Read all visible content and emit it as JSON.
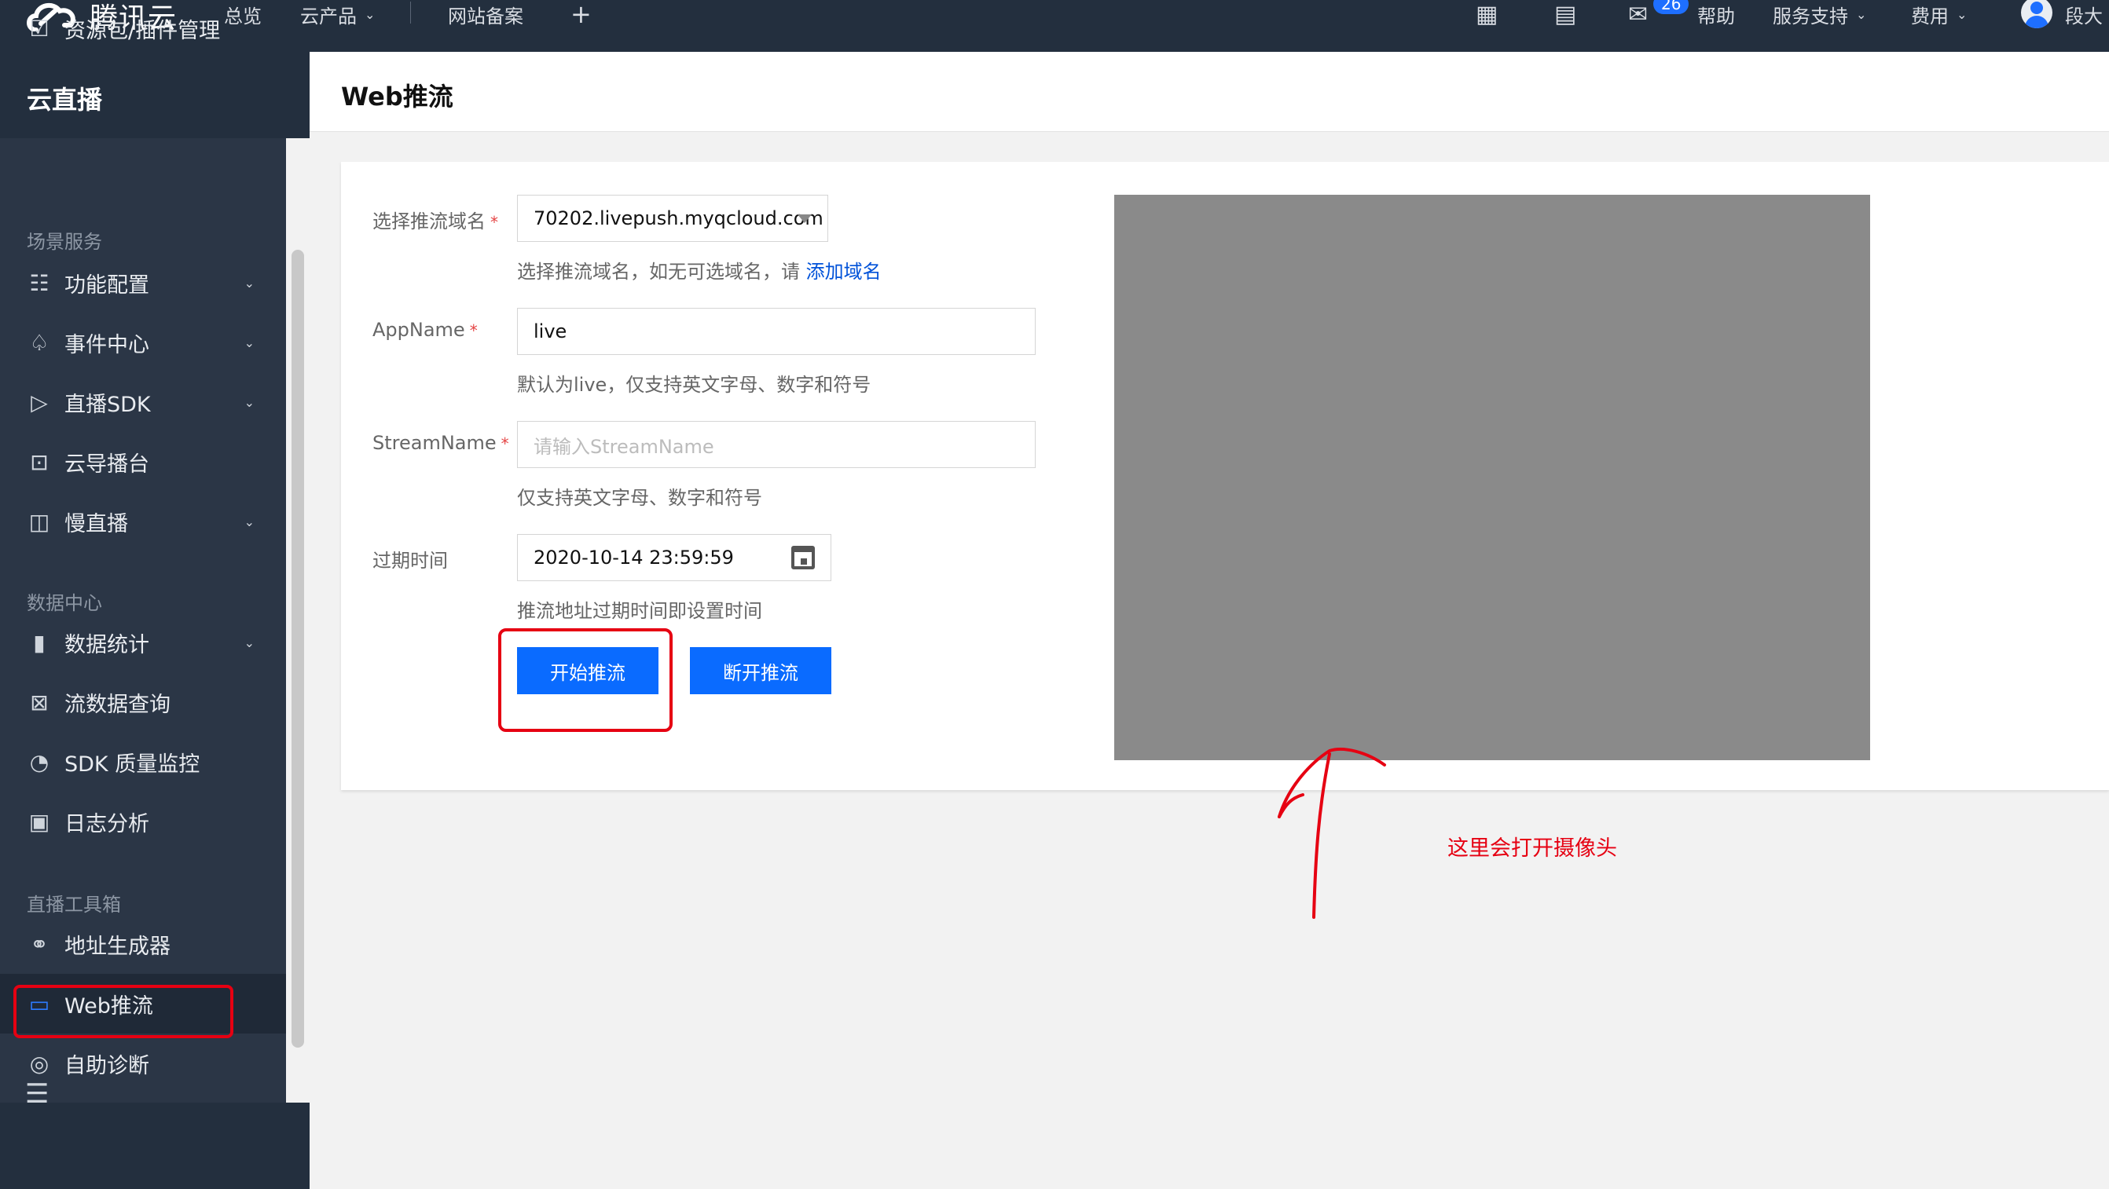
{
  "brand": {
    "name": "腾讯云"
  },
  "topnav": {
    "items": [
      "总览",
      "云产品",
      "网站备案"
    ],
    "plus": "+",
    "mail_badge": "26",
    "help": "帮助",
    "support": "服务支持",
    "billing": "费用",
    "user": "段大"
  },
  "sidebar": {
    "title": "云直播",
    "items": [
      {
        "label": "资源包/插件管理",
        "icon": "package-icon"
      },
      {
        "label": "功能配置",
        "icon": "sliders-icon"
      },
      {
        "label": "事件中心",
        "icon": "bell-icon"
      },
      {
        "label": "直播SDK",
        "icon": "play-icon"
      },
      {
        "label": "云导播台",
        "icon": "monitor-icon"
      },
      {
        "label": "慢直播",
        "icon": "camera-icon"
      },
      {
        "label": "数据统计",
        "icon": "bar-chart-icon"
      },
      {
        "label": "流数据查询",
        "icon": "line-chart-icon"
      },
      {
        "label": "SDK 质量监控",
        "icon": "gauge-icon"
      },
      {
        "label": "日志分析",
        "icon": "calendar-icon"
      },
      {
        "label": "地址生成器",
        "icon": "link-icon"
      },
      {
        "label": "Web推流",
        "icon": "window-icon"
      },
      {
        "label": "自助诊断",
        "icon": "diagnose-icon"
      }
    ],
    "groups": [
      "场景服务",
      "数据中心",
      "直播工具箱"
    ],
    "active_color": "#2d7bff"
  },
  "page": {
    "title": "Web推流"
  },
  "form": {
    "domain": {
      "label": "选择推流域名",
      "value": "70202.livepush.myqcloud.com",
      "hint": "选择推流域名，如无可选域名，请 ",
      "hint_link": "添加域名"
    },
    "appname": {
      "label": "AppName",
      "value": "live",
      "hint": "默认为live，仅支持英文字母、数字和符号"
    },
    "streamname": {
      "label": "StreamName",
      "placeholder": "请输入StreamName",
      "hint": "仅支持英文字母、数字和符号"
    },
    "expire": {
      "label": "过期时间",
      "value": "2020-10-14 23:59:59",
      "hint": "推流地址过期时间即设置时间"
    },
    "required_mark": "*",
    "start_button": "开始推流",
    "stop_button": "断开推流",
    "button_color": "#0a6bff"
  },
  "annotation": {
    "text": "这里会打开摄像头",
    "color": "#e60012"
  }
}
